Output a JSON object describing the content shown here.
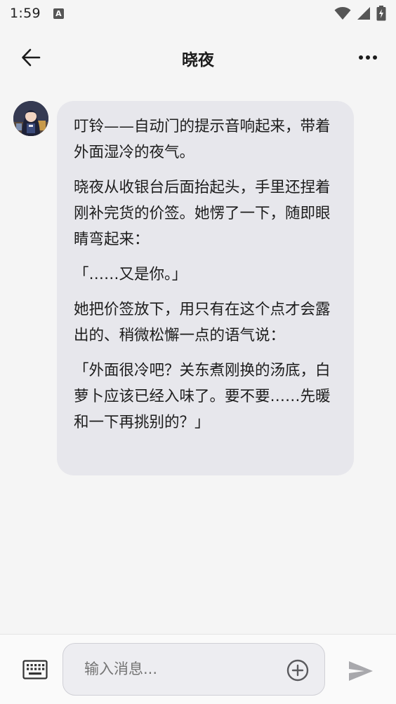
{
  "status_bar": {
    "time": "1:59",
    "app_icon_letter": "A",
    "icons": [
      "wifi-icon",
      "cellular-signal-icon",
      "battery-charging-icon"
    ]
  },
  "header": {
    "title": "晓夜",
    "back_icon": "arrow-left-icon",
    "more_icon": "more-dots-icon"
  },
  "message": {
    "paragraphs": [
      "叮铃——自动门的提示音响起来，带着外面湿冷的夜气。",
      "晓夜从收银台后面抬起头，手里还捏着刚补完货的价签。她愣了一下，随即眼睛弯起来：",
      "「……又是你。」",
      "她把价签放下，用只有在这个点才会露出的、稍微松懈一点的语气说：",
      "「外面很冷吧？关东煮刚换的汤底，白萝卜应该已经入味了。要不要……先暖和一下再挑别的？」"
    ]
  },
  "composer": {
    "placeholder": "输入消息...",
    "keyboard_icon": "keyboard-icon",
    "add_icon": "plus-circle-icon",
    "send_icon": "send-icon"
  },
  "colors": {
    "background": "#f5f5f5",
    "bubble": "#e7e7ec",
    "text": "#1c1c1c",
    "placeholder": "#8a8a8e",
    "icon_muted": "#a8a8ac"
  }
}
